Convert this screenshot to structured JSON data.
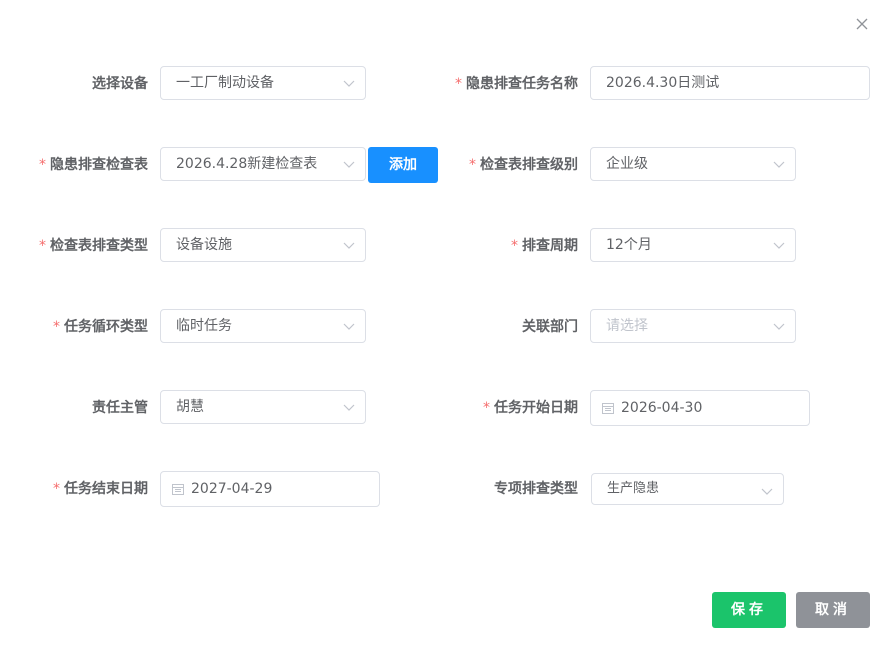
{
  "dialog": {
    "close_icon": "close-icon"
  },
  "form": {
    "equipment": {
      "label": "选择设备",
      "required": false,
      "value": "一工厂制动设备"
    },
    "task_name": {
      "label": "隐患排查任务名称",
      "required": true,
      "value": "2026.4.30日测试"
    },
    "checklist": {
      "label": "隐患排查检查表",
      "required": true,
      "value": "2026.4.28新建检查表",
      "add_label": "添加"
    },
    "check_level": {
      "label": "检查表排查级别",
      "required": true,
      "value": "企业级"
    },
    "check_type": {
      "label": "检查表排查类型",
      "required": true,
      "value": "设备设施"
    },
    "check_cycle": {
      "label": "排查周期",
      "required": true,
      "value": "12个月"
    },
    "task_cycle_type": {
      "label": "任务循环类型",
      "required": true,
      "value": "临时任务"
    },
    "related_dept": {
      "label": "关联部门",
      "required": false,
      "placeholder": "请选择"
    },
    "supervisor": {
      "label": "责任主管",
      "required": false,
      "value": "胡慧"
    },
    "start_date": {
      "label": "任务开始日期",
      "required": true,
      "value": "2026-04-30"
    },
    "end_date": {
      "label": "任务结束日期",
      "required": true,
      "value": "2027-04-29"
    },
    "special_type": {
      "label": "专项排查类型",
      "required": false,
      "value": "生产隐患"
    }
  },
  "footer": {
    "save_label": "保存",
    "cancel_label": "取消"
  },
  "colors": {
    "required_star": "#f56c6c",
    "primary": "#1890ff",
    "save": "#1bc46b",
    "cancel": "#8f9298",
    "border": "#dcdfe6"
  }
}
